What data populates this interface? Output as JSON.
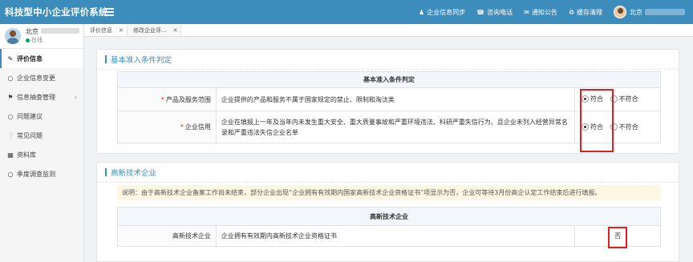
{
  "header": {
    "app_title": "科技型中小企业评价系统",
    "nav": [
      {
        "icon": "user-icon",
        "label": "企业信息同步"
      },
      {
        "icon": "phone-icon",
        "label": "咨询电话"
      },
      {
        "icon": "message-icon",
        "label": "通知公告"
      },
      {
        "icon": "recycle-icon",
        "label": "缓存清理"
      }
    ],
    "user_name": "北京"
  },
  "sidebar": {
    "user_name": "北京",
    "status": "在线",
    "items": [
      {
        "icon": "edit-icon",
        "label": "评价信息",
        "active": true
      },
      {
        "icon": "circle-icon",
        "label": "企业信息变更"
      },
      {
        "icon": "tags-icon",
        "label": "信息抽查管理",
        "has_arrow": true
      },
      {
        "icon": "chat-icon",
        "label": "问题建议"
      },
      {
        "icon": "question-icon",
        "label": "常见问题"
      },
      {
        "icon": "folder-icon",
        "label": "资料库"
      },
      {
        "icon": "circle-icon",
        "label": "季度调查监测"
      }
    ]
  },
  "tabs": [
    {
      "label": "评价信息"
    },
    {
      "label": "修改企业评..."
    }
  ],
  "section1": {
    "title": "基本准入条件判定",
    "table_header": "基本准入条件判定",
    "rows": [
      {
        "label": "产品及服务范围",
        "desc": "企业提供的产品和服务不属于国家规定的禁止、限制和淘汰类",
        "opt_yes": "符合",
        "opt_no": "不符合"
      },
      {
        "label": "企业信用",
        "desc": "企业在填报上一年及当年内未发生重大安全、重大质量事故和严重环境违法、科研严重失信行为、且企业未列入经营异常名录和严重违法失信企业名单",
        "opt_yes": "符合",
        "opt_no": "不符合"
      }
    ]
  },
  "section2": {
    "title": "高新技术企业",
    "notice": "说明：由于高新技术企业备案工作尚未结束，部分企业出现“企业拥有有效期内国家高新技术企业资格证书”项显示为否，企业可等待3月份高企认定工作结束后进行填报。",
    "table_header": "高新技术企业",
    "row": {
      "label": "高新技术企业",
      "desc": "企业拥有有效期内高新技术企业资格证书",
      "value": "否"
    }
  },
  "colors": {
    "header_bg": "#3c8dbc",
    "accent": "#3c8dbc",
    "highlight_box": "#e02020",
    "required": "#e02020"
  }
}
